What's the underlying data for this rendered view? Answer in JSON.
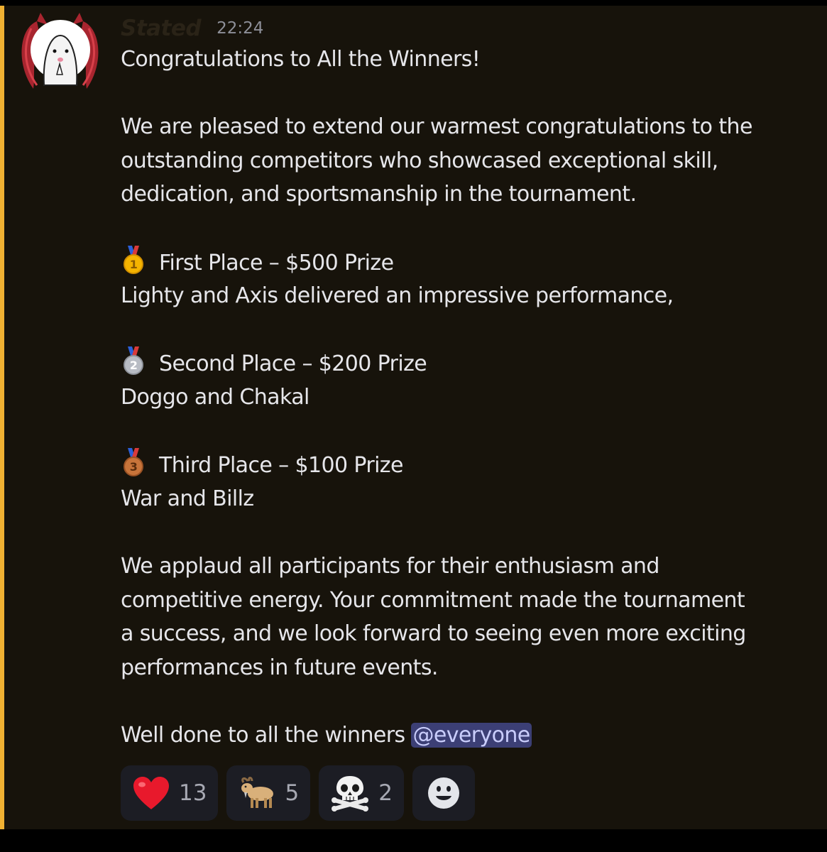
{
  "message": {
    "username": "Stated",
    "timestamp": "22:24",
    "colors": {
      "background": "#17130b",
      "mention_bar": "#f0b132",
      "text": "#e6e6ea",
      "mention_bg": "#3c3f75",
      "mention_text": "#c9cdfb",
      "reaction_bg": "#1c1d24"
    },
    "title": "Congratulations to All the Winners!",
    "intro_lines": [
      "We are pleased to extend our warmest congratulations to the",
      "outstanding competitors who showcased exceptional skill,",
      "dedication, and sportsmanship in the tournament."
    ],
    "places": [
      {
        "medal_icon": "first-place-medal-icon",
        "heading": "First Place – $500 Prize",
        "winners": "Lighty and Axis delivered an impressive performance,"
      },
      {
        "medal_icon": "second-place-medal-icon",
        "heading": "Second Place – $200 Prize",
        "winners": "Doggo and Chakal"
      },
      {
        "medal_icon": "third-place-medal-icon",
        "heading": "Third Place – $100 Prize",
        "winners": "War and Billz"
      }
    ],
    "closing_lines": [
      "We applaud all participants for their enthusiasm and",
      "competitive energy. Your commitment made the tournament",
      "a success, and we look forward to seeing even more exciting",
      "performances in future events."
    ],
    "final_text": "Well done to all the winners ",
    "mention": "@everyone"
  },
  "reactions": [
    {
      "icon": "heart-icon",
      "count": "13"
    },
    {
      "icon": "goat-icon",
      "count": "5"
    },
    {
      "icon": "skull-crossbones-icon",
      "count": "2"
    }
  ],
  "add_reaction_icon": "smiley-add-reaction-icon"
}
